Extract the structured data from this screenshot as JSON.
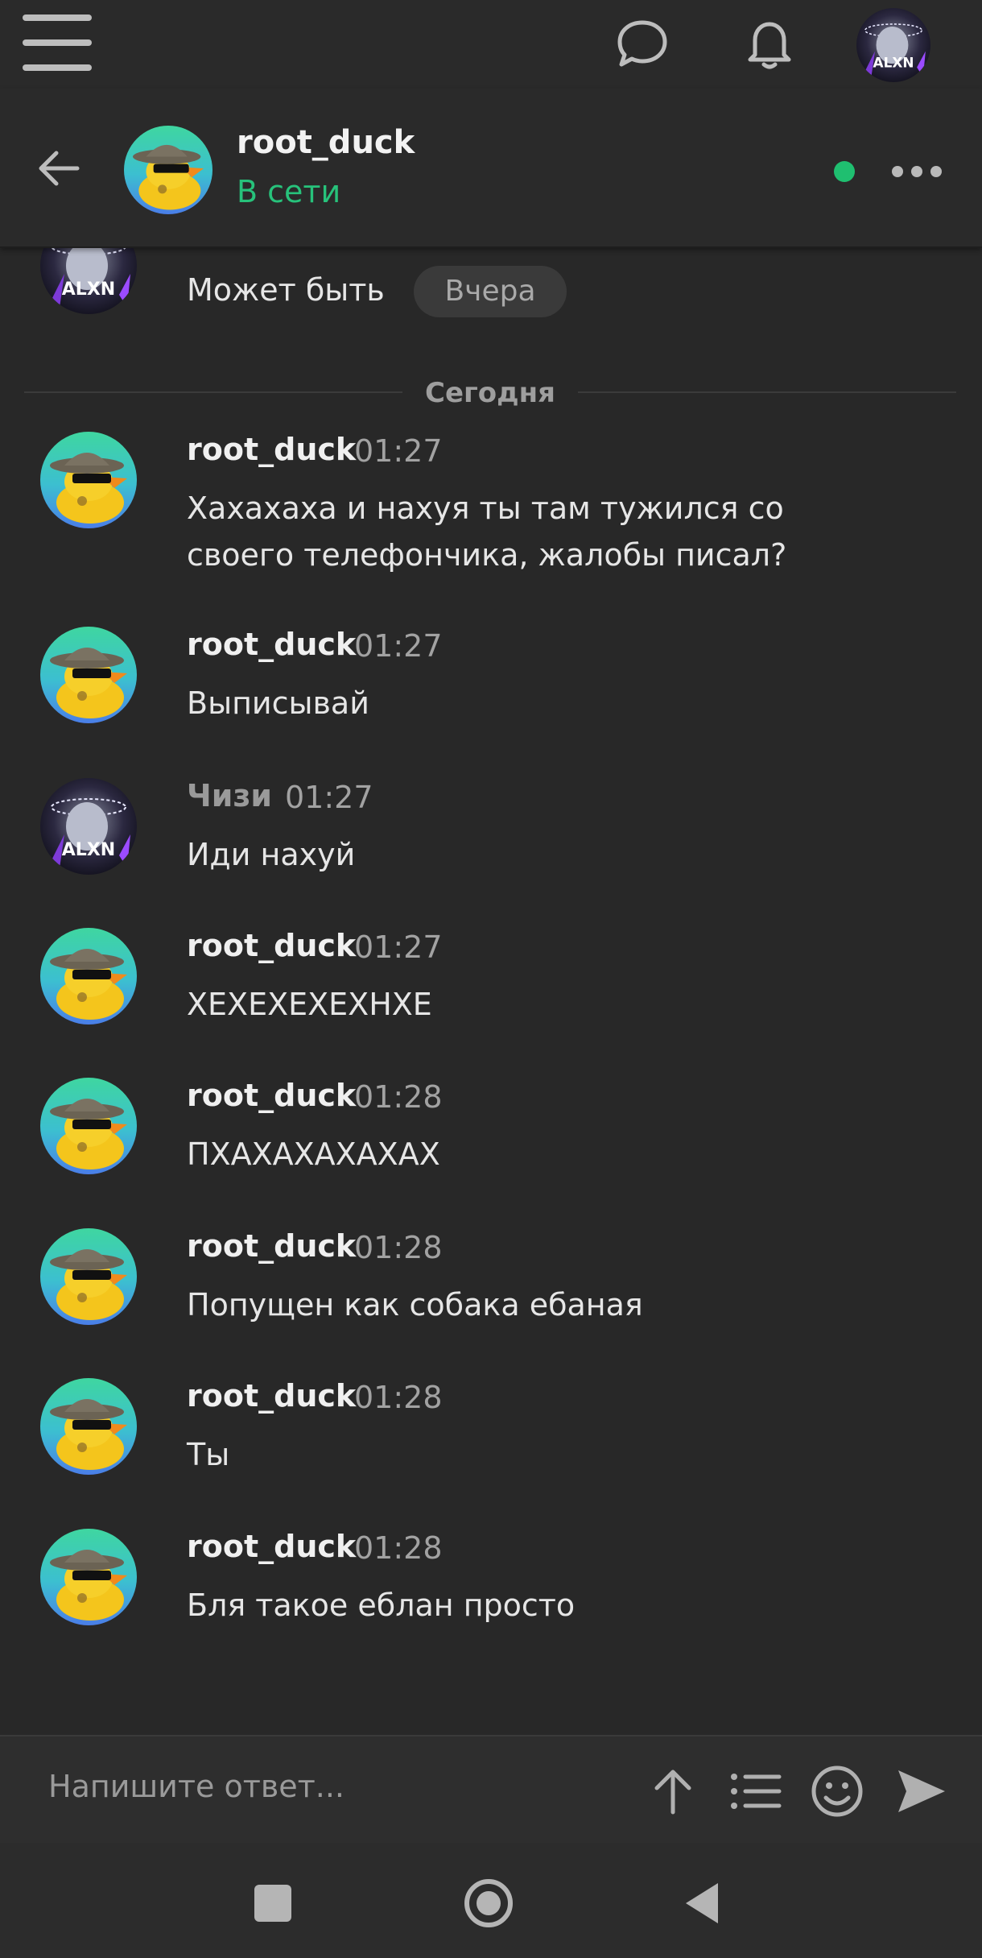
{
  "top_bar": {
    "icons": [
      "menu-icon",
      "chat-bubble-icon",
      "bell-icon"
    ],
    "user_avatar": "user-avatar"
  },
  "chat_header": {
    "back_icon": "arrow-left-icon",
    "contact_name": "root_duck",
    "status": "В сети",
    "status_color": "#27c27b",
    "more_icon": "more-horizontal-icon"
  },
  "partial_message": {
    "text": "Может быть",
    "badge": "Вчера"
  },
  "date_divider": "Сегодня",
  "messages": [
    {
      "author": "root_duck",
      "time": "01:27",
      "text": "Хахахаха и нахуя ты там тужился со своего телефончика, жалобы писал?"
    },
    {
      "author": "root_duck",
      "time": "01:27",
      "text": "Выписывай"
    },
    {
      "author": "Чизи",
      "time": "01:27",
      "text": "Иди нахуй"
    },
    {
      "author": "root_duck",
      "time": "01:27",
      "text": "ХЕХЕХЕХЕХНХЕ"
    },
    {
      "author": "root_duck",
      "time": "01:28",
      "text": "ПХАХАХАХАХАХ"
    },
    {
      "author": "root_duck",
      "time": "01:28",
      "text": "Попущен как собака ебаная"
    },
    {
      "author": "root_duck",
      "time": "01:28",
      "text": "Ты"
    },
    {
      "author": "root_duck",
      "time": "01:28",
      "text": "Бля такое еблан просто"
    }
  ],
  "composer": {
    "placeholder": "Напишите ответ...",
    "icons": [
      "arrow-up-icon",
      "list-icon",
      "emoji-icon",
      "send-icon"
    ]
  },
  "system_nav": [
    "square-icon",
    "circle-icon",
    "triangle-back-icon"
  ],
  "colors": {
    "background": "#282828",
    "accent_green": "#1fbf70"
  }
}
